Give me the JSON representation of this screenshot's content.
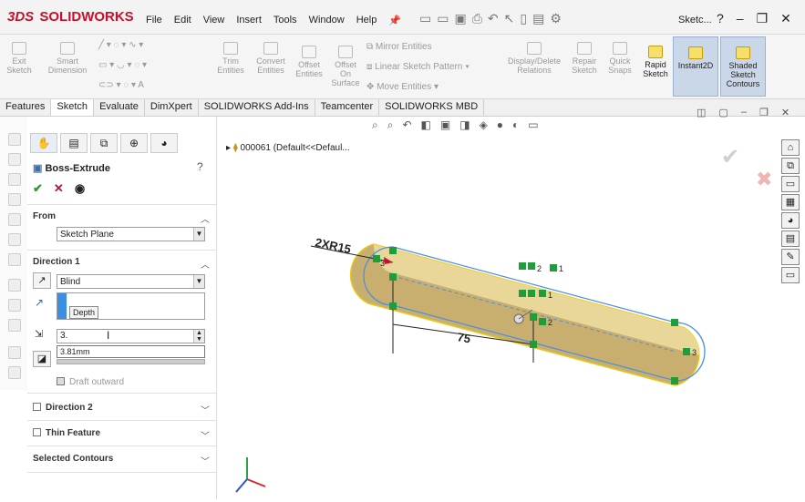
{
  "app": {
    "logo_prefix": "3DS",
    "logo_text": "SOLIDWORKS",
    "window_title": "Sketc...",
    "help_label": "?"
  },
  "menu": [
    "File",
    "Edit",
    "View",
    "Insert",
    "Tools",
    "Window",
    "Help"
  ],
  "ribbon": {
    "exit_sketch": "Exit Sketch",
    "smart_dimension": "Smart Dimension",
    "trim_entities": "Trim Entities",
    "convert_entities": "Convert Entities",
    "offset_entities": "Offset Entities",
    "offset_on_surface": "Offset On Surface",
    "mirror_entities": "Mirror Entities",
    "linear_pattern": "Linear Sketch Pattern",
    "move_entities": "Move Entities",
    "display_delete": "Display/Delete Relations",
    "repair_sketch": "Repair Sketch",
    "quick_snaps": "Quick Snaps",
    "rapid_sketch": "Rapid Sketch",
    "instant2d": "Instant2D",
    "shaded_contours": "Shaded Sketch Contours"
  },
  "tabs": [
    "Features",
    "Sketch",
    "Evaluate",
    "DimXpert",
    "SOLIDWORKS Add-Ins",
    "Teamcenter",
    "SOLIDWORKS MBD"
  ],
  "active_tab": "Sketch",
  "property_manager": {
    "feature_name": "Boss-Extrude",
    "help_icon": "?",
    "ok": "✔",
    "cancel": "✕",
    "from_label": "From",
    "from_value": "Sketch Plane",
    "direction1_label": "Direction 1",
    "end_condition": "Blind",
    "depth_tooltip": "Depth",
    "depth_input": "3.",
    "depth_suggestion": "3.81mm",
    "draft_outward": "Draft outward",
    "direction2_label": "Direction 2",
    "thin_feature_label": "Thin Feature",
    "selected_contours_label": "Selected Contours"
  },
  "tree": {
    "part_name": "000061",
    "config": "(Default<<Defaul..."
  },
  "sketch": {
    "radius_dim": "2XR15",
    "length_dim": "75",
    "relation_labels": [
      "3",
      "2",
      "1",
      "1",
      "2",
      "3"
    ]
  },
  "colors": {
    "accent": "#1f7ad6",
    "sketch_fill": "#c4a760",
    "relation_green": "#1f9d3a",
    "logo_red": "#c8102e"
  }
}
